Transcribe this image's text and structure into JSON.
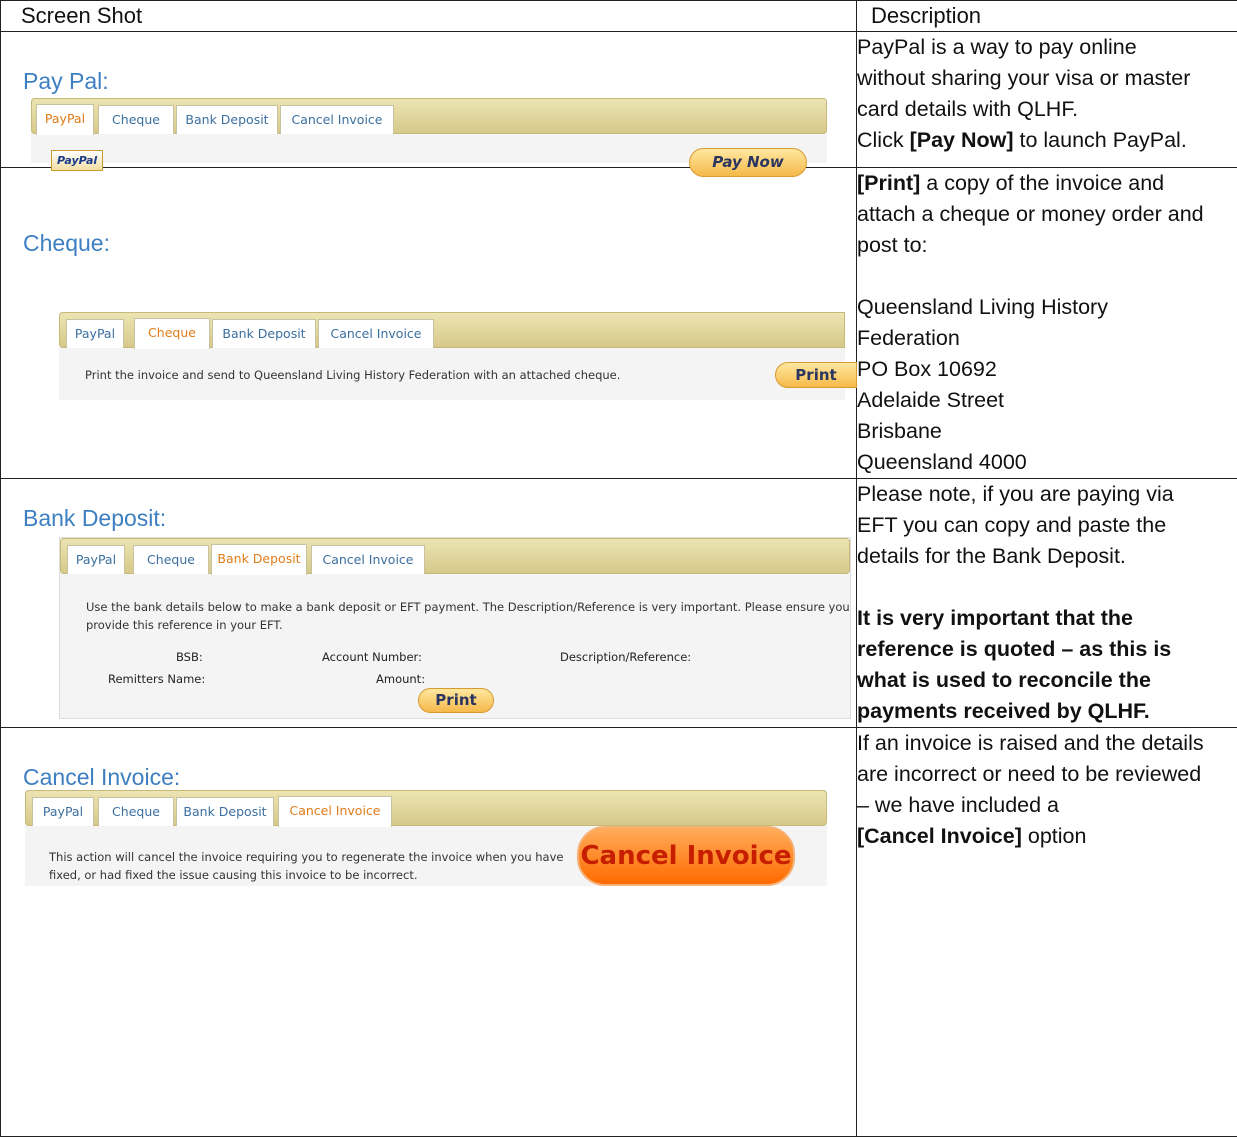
{
  "header": {
    "screenshot": "Screen Shot",
    "description": "Description"
  },
  "tabs": [
    "PayPal",
    "Cheque",
    "Bank Deposit",
    "Cancel Invoice"
  ],
  "paypal": {
    "title": "Pay Pal:",
    "logo": "PayPal",
    "button": "Pay Now",
    "desc": [
      "PayPal is a way to pay online",
      "without sharing your visa or master",
      "card details with QLHF."
    ],
    "desc_pre": "Click ",
    "desc_bold": "[Pay Now]",
    "desc_post": " to launch PayPal."
  },
  "cheque": {
    "title": "Cheque:",
    "panel_text": "Print the invoice and send to Queensland Living History Federation with an attached cheque.",
    "button": "Print",
    "desc_bold": "[Print]",
    "desc_post": " a copy of the invoice and",
    "desc_lines": [
      "attach a cheque or money order and",
      "post to:"
    ],
    "address": [
      "Queensland Living History",
      "Federation",
      "PO Box 10692",
      "Adelaide Street",
      "Brisbane",
      "Queensland 4000"
    ]
  },
  "bank": {
    "title": "Bank Deposit:",
    "panel_line1": "Use the bank details below to make a bank deposit or EFT payment. The Description/Reference is very important. Please ensure you",
    "panel_line2": "provide this reference in your EFT.",
    "bsb": "BSB:",
    "account": "Account Number:",
    "reference": "Description/Reference:",
    "remitter": "Remitters Name:",
    "amount": "Amount:",
    "button": "Print",
    "desc": [
      "Please note, if you are paying via",
      "EFT you can copy and paste the",
      "details for the Bank Deposit."
    ],
    "desc_bold": [
      "It is very important that the",
      "reference is quoted – as this is",
      "what is used to reconcile the",
      "payments received by QLHF."
    ]
  },
  "cancel": {
    "title": "Cancel Invoice:",
    "panel_line1": "This action will cancel the invoice requiring you to regenerate the invoice when you have",
    "panel_line2": "fixed, or had fixed the issue causing this invoice to be incorrect.",
    "button": "Cancel Invoice",
    "desc": [
      "If an invoice is raised and the details",
      "are incorrect or need to be reviewed",
      "– we have included a"
    ],
    "desc_bold": "[Cancel Invoice]",
    "desc_post": " option"
  }
}
